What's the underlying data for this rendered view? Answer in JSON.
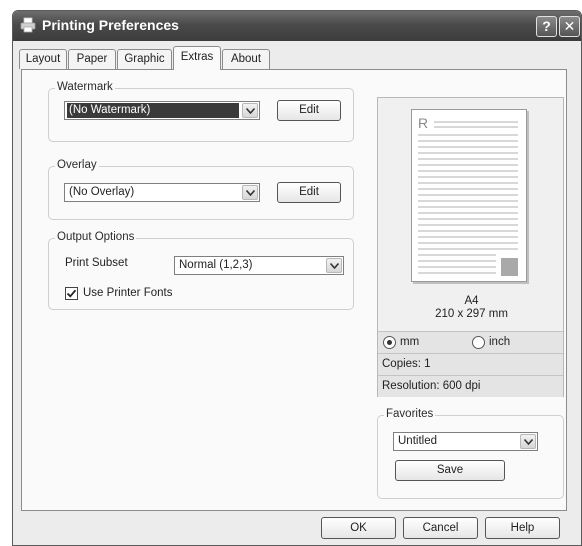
{
  "window": {
    "title": "Printing Preferences",
    "help_glyph": "?",
    "close_glyph": "✕"
  },
  "tabs": [
    {
      "label": "Layout"
    },
    {
      "label": "Paper"
    },
    {
      "label": "Graphic"
    },
    {
      "label": "Extras"
    },
    {
      "label": "About"
    }
  ],
  "active_tab": "Extras",
  "watermark": {
    "group_label": "Watermark",
    "selected": "(No Watermark)",
    "edit_label": "Edit"
  },
  "overlay": {
    "group_label": "Overlay",
    "selected": "(No Overlay)",
    "edit_label": "Edit"
  },
  "output_options": {
    "group_label": "Output Options",
    "print_subset_label": "Print Subset",
    "print_subset_value": "Normal (1,2,3)",
    "use_printer_fonts_label": "Use Printer Fonts",
    "use_printer_fonts_checked": true
  },
  "preview": {
    "page_letter": "R",
    "paper_name": "A4",
    "paper_size": "210 x 297 mm",
    "unit_mm_label": "mm",
    "unit_inch_label": "inch",
    "selected_unit": "mm",
    "copies": "Copies: 1",
    "resolution": "Resolution: 600 dpi"
  },
  "favorites": {
    "group_label": "Favorites",
    "selected": "Untitled",
    "save_label": "Save"
  },
  "footer": {
    "ok_label": "OK",
    "cancel_label": "Cancel",
    "help_label": "Help"
  },
  "icons": {
    "title": "printer-icon",
    "dropdown": "chevron-down-icon",
    "check": "checkmark-icon"
  }
}
